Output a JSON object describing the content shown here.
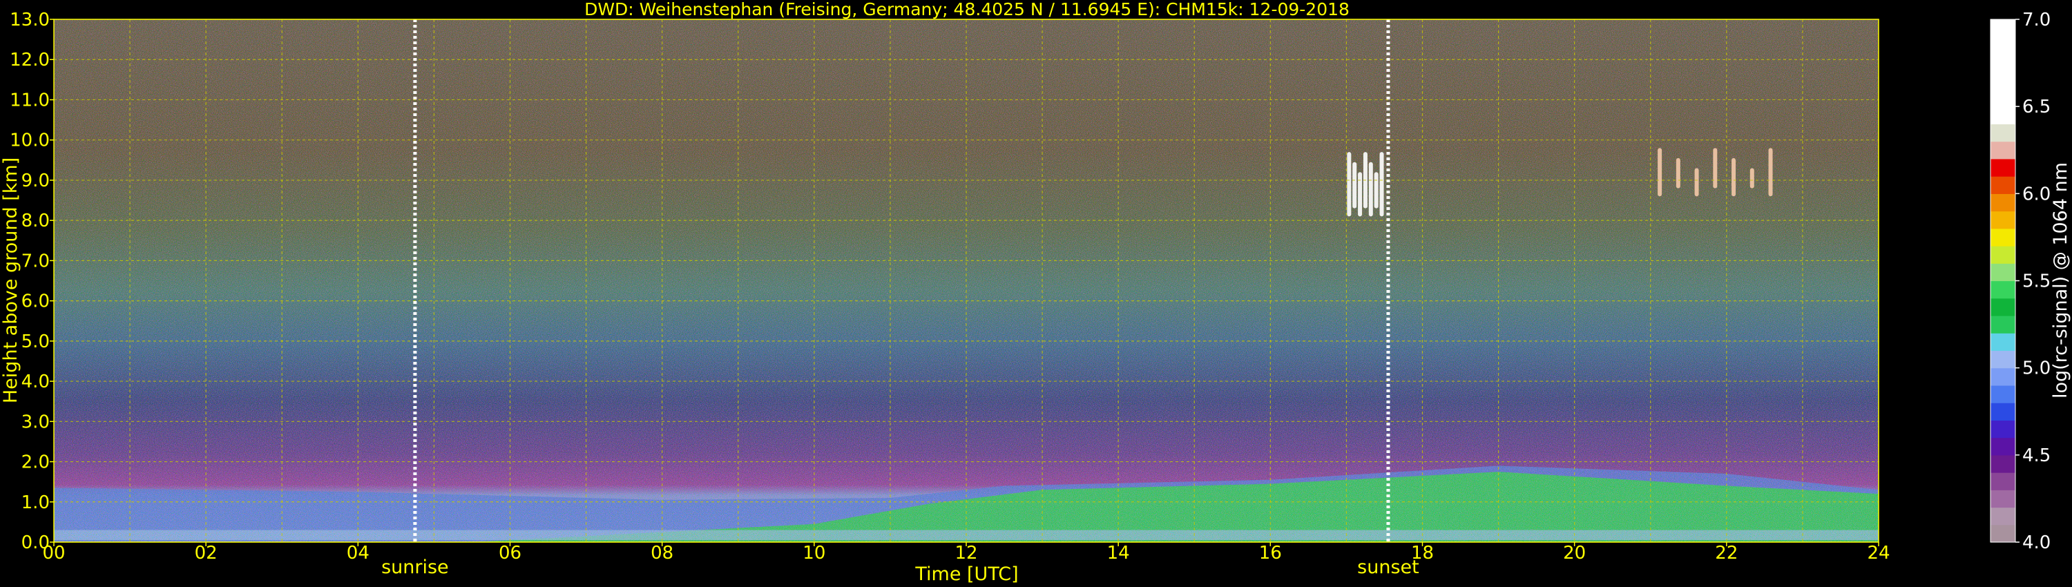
{
  "chart_data": {
    "type": "heatmap",
    "title": "DWD: Weihenstephan (Freising, Germany; 48.4025 N / 11.6945 E):    CHM15k: 12-09-2018",
    "xlabel": "Time [UTC]",
    "ylabel": "Height above ground [km]",
    "xlim": [
      0,
      24
    ],
    "ylim": [
      0,
      13
    ],
    "x_ticks": [
      "00",
      "02",
      "04",
      "06",
      "08",
      "10",
      "12",
      "14",
      "16",
      "18",
      "20",
      "22",
      "24"
    ],
    "y_ticks": [
      "0.0",
      "1.0",
      "2.0",
      "3.0",
      "4.0",
      "5.0",
      "6.0",
      "7.0",
      "8.0",
      "9.0",
      "10.0",
      "11.0",
      "12.0",
      "13.0"
    ],
    "grid": true,
    "colorbar": {
      "label": "log(rc-signal) @ 1064 nm",
      "range": [
        4.0,
        7.0
      ],
      "ticks": [
        "4.0",
        "4.5",
        "5.0",
        "5.5",
        "6.0",
        "6.5",
        "7.0"
      ]
    },
    "events": [
      {
        "label": "sunrise",
        "time": 4.75
      },
      {
        "label": "sunset",
        "time": 17.55
      }
    ],
    "features": {
      "mixing_layer_top_km": [
        {
          "t": 0,
          "h": 1.35
        },
        {
          "t": 4,
          "h": 1.25
        },
        {
          "t": 8,
          "h": 1.05
        },
        {
          "t": 11,
          "h": 1.1
        },
        {
          "t": 12.5,
          "h": 1.4
        },
        {
          "t": 16,
          "h": 1.55
        },
        {
          "t": 19,
          "h": 1.9
        },
        {
          "t": 22,
          "h": 1.7
        },
        {
          "t": 24,
          "h": 1.3
        }
      ],
      "cirrus_clouds": [
        {
          "t_start": 17.0,
          "t_end": 17.5,
          "h_bottom": 8.1,
          "h_top": 9.7
        },
        {
          "t_start": 21.0,
          "t_end": 22.7,
          "h_bottom": 8.6,
          "h_top": 9.8
        }
      ]
    }
  },
  "colors": {
    "text": "#ffff00",
    "grid": "#c8c800",
    "event_line": "#ffffff",
    "colorbar_text": "#ffffff"
  }
}
